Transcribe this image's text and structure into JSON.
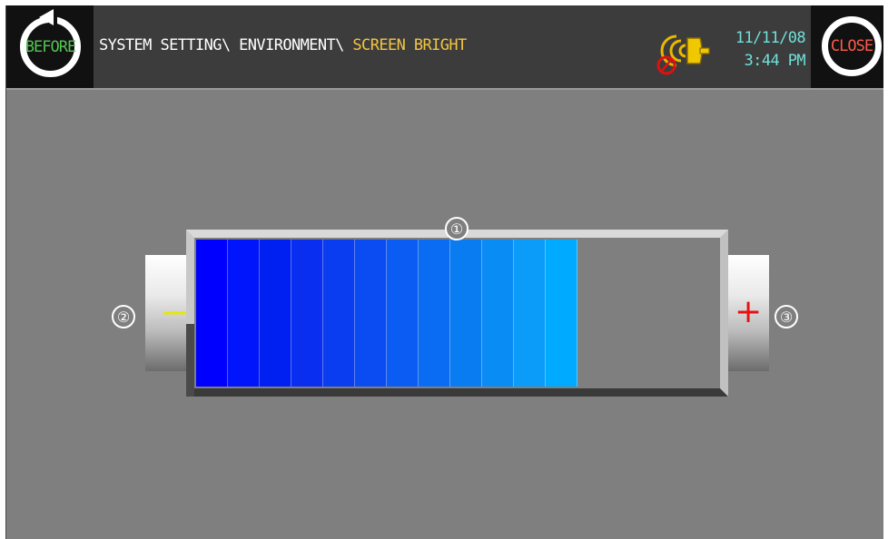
{
  "header": {
    "before_label": "BEFORE",
    "close_label": "CLOSE",
    "breadcrumb": {
      "path": "SYSTEM SETTING\\ ENVIRONMENT\\ ",
      "current": "SCREEN BRIGHT"
    },
    "date": "11/11/08",
    "time": "3:44 PM",
    "alarm_icon": "alarm-bell-icon"
  },
  "brightness": {
    "level": 12,
    "max": 16,
    "marker_bar": "①",
    "marker_decrease": "②",
    "marker_increase": "③",
    "decrease_symbol": "—",
    "increase_symbol": "+"
  },
  "colors": {
    "before_text": "#53c553",
    "close_text": "#ff5a4a",
    "breadcrumb_current": "#f4c542",
    "datetime": "#6fe0d8",
    "minus": "#e8e800",
    "plus": "#e81010",
    "segments": [
      "#0000ff",
      "#0015fb",
      "#0020f2",
      "#0a2ef0",
      "#0a3cf0",
      "#0a4cf2",
      "#0a5cf2",
      "#0a6cf2",
      "#0a7cf2",
      "#0a8cf5",
      "#0a9cf8",
      "#00aaff"
    ]
  }
}
